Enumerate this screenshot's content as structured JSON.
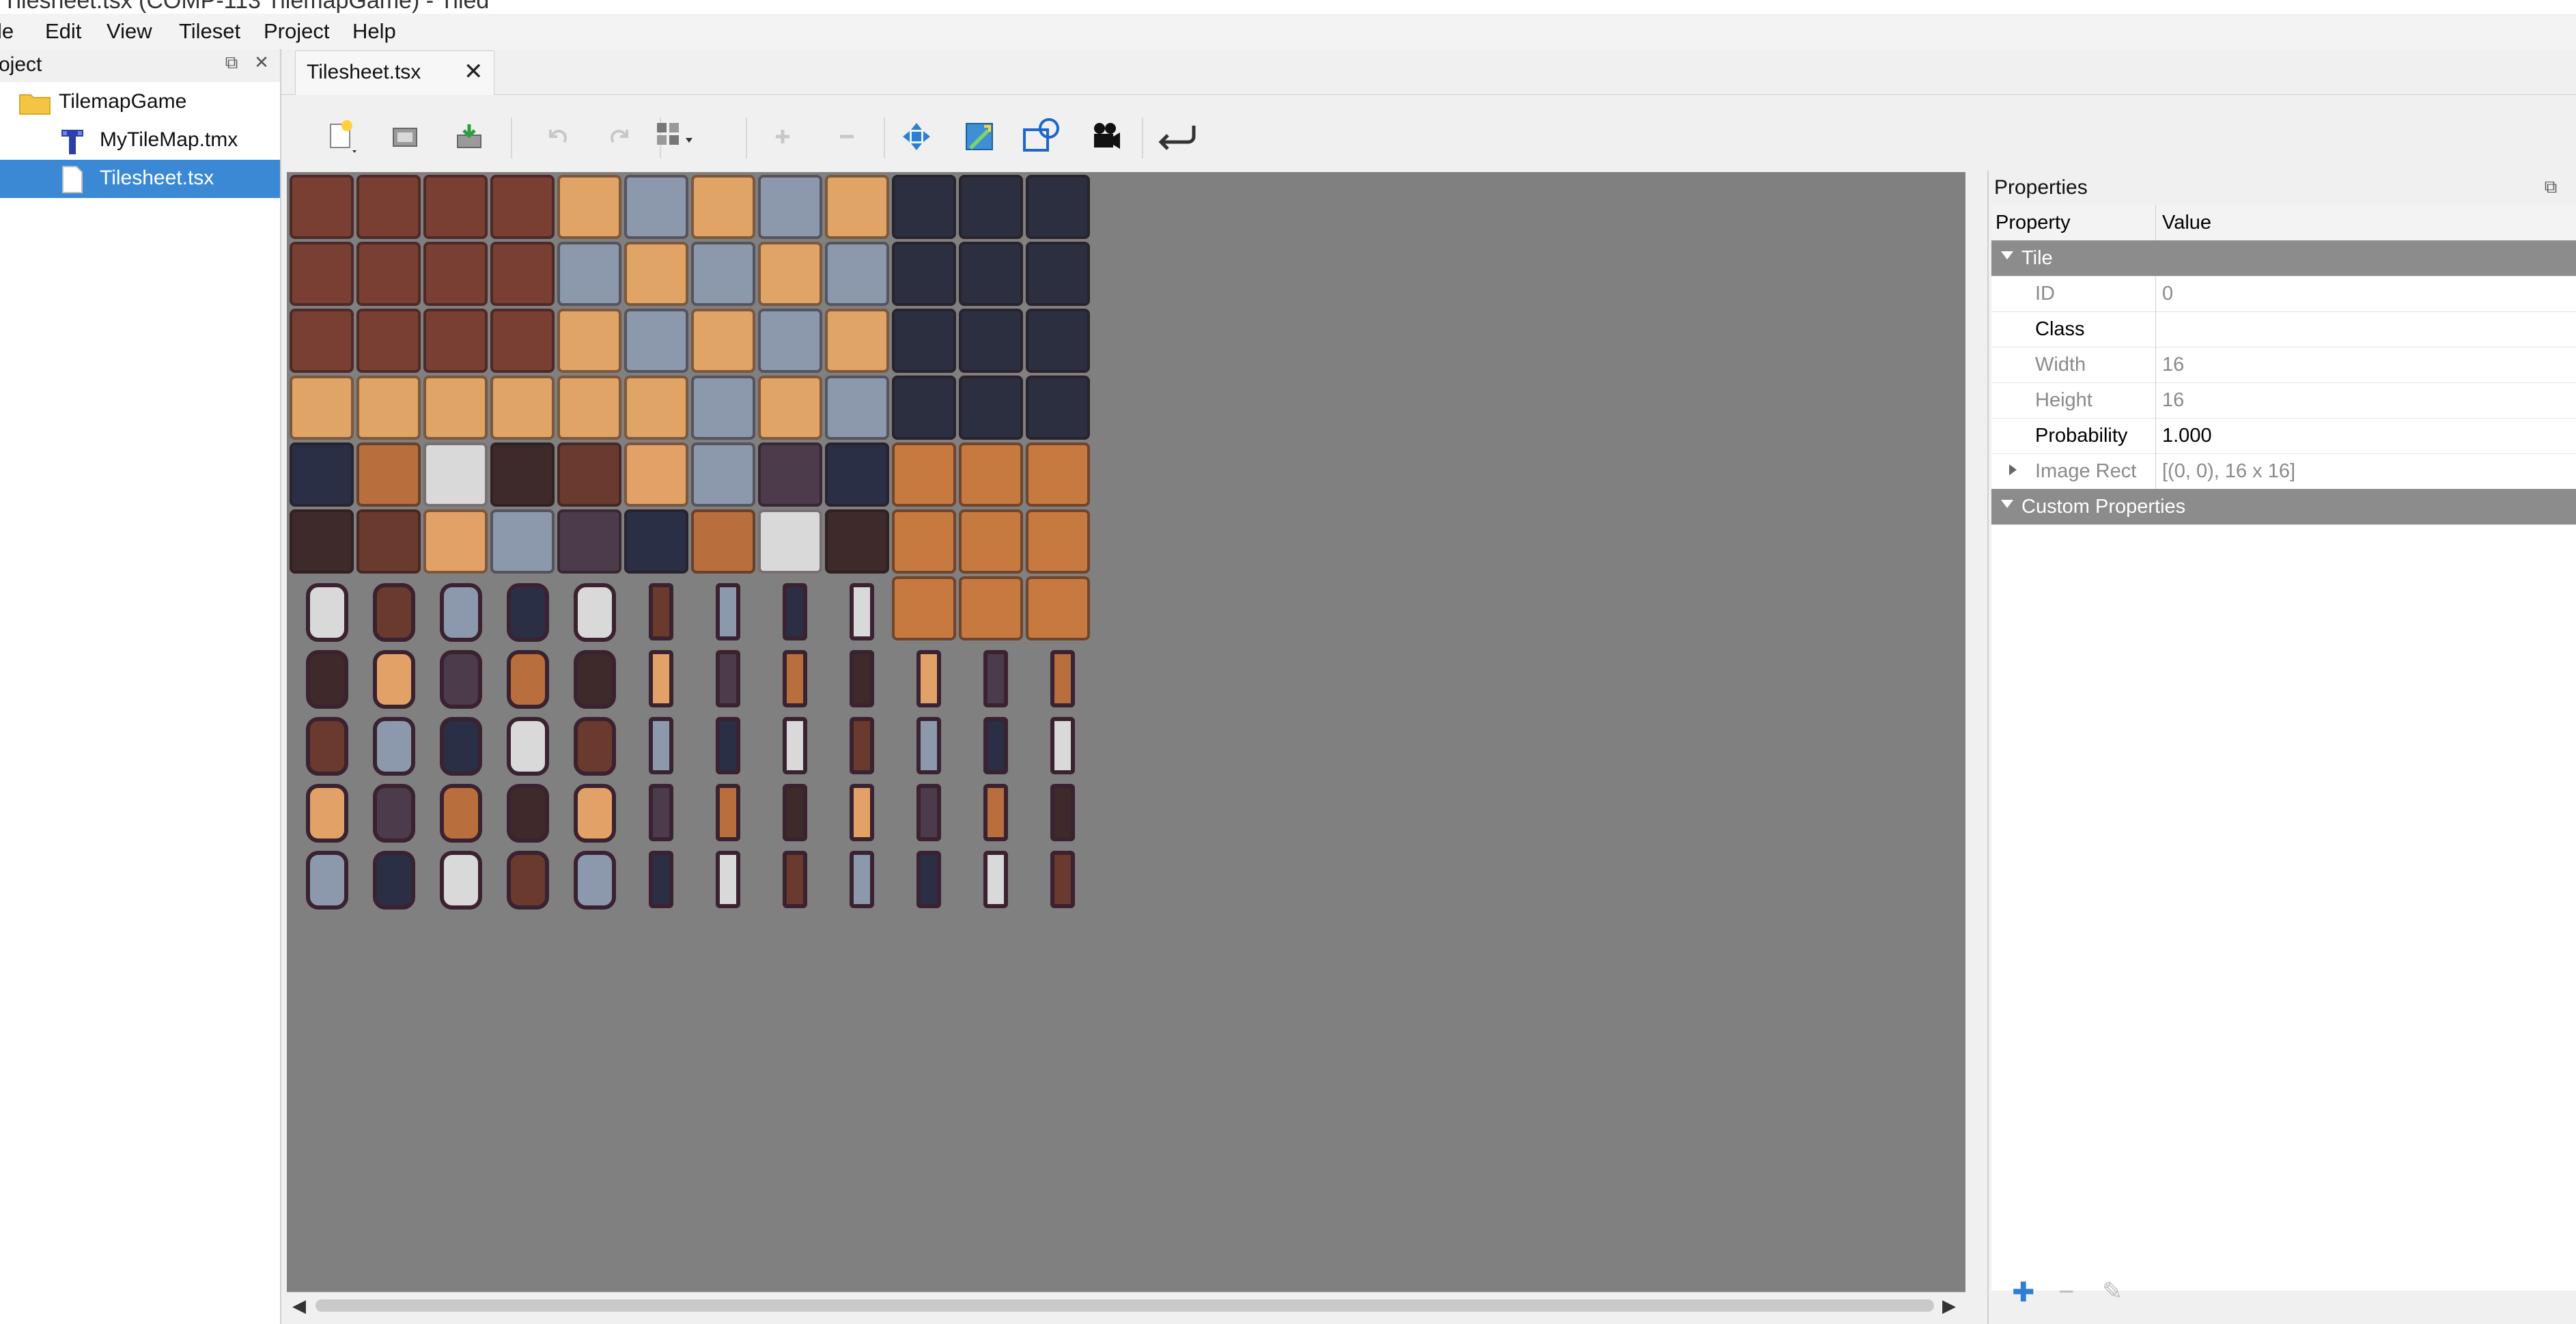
{
  "window": {
    "title": "Tilesheet.tsx (COMP-113 TilemapGame) - Tiled"
  },
  "menu": {
    "items": [
      "le",
      "Edit",
      "View",
      "Tileset",
      "Project",
      "Help"
    ]
  },
  "project_panel": {
    "title": "oject",
    "tree": [
      {
        "label": "TilemapGame",
        "icon": "folder-icon",
        "level": 0,
        "selected": false
      },
      {
        "label": "MyTileMap.tmx",
        "icon": "tilemap-icon",
        "level": 1,
        "selected": false
      },
      {
        "label": "Tilesheet.tsx",
        "icon": "file-icon",
        "level": 1,
        "selected": true
      }
    ]
  },
  "tabs": [
    {
      "label": "Tilesheet.tsx",
      "active": true
    }
  ],
  "toolbar": {
    "buttons": [
      "new-tileset-icon",
      "open-icon",
      "save-icon",
      "undo-icon",
      "redo-icon",
      "dynamic-wrapping-icon",
      "add-tiles-icon",
      "remove-tiles-icon",
      "move-icon",
      "edit-collision-icon",
      "shape-select-icon",
      "animation-editor-icon",
      "rearrange-icon"
    ]
  },
  "properties": {
    "title": "Properties",
    "header": {
      "property": "Property",
      "value": "Value"
    },
    "groups": [
      {
        "name": "Tile",
        "rows": [
          {
            "key": "ID",
            "value": "0",
            "editable": false
          },
          {
            "key": "Class",
            "value": "",
            "editable": true
          },
          {
            "key": "Width",
            "value": "16",
            "editable": false
          },
          {
            "key": "Height",
            "value": "16",
            "editable": false
          },
          {
            "key": "Probability",
            "value": "1.000",
            "editable": true
          },
          {
            "key": "Image Rect",
            "value": "[(0, 0), 16 x 16]",
            "editable": false
          }
        ]
      },
      {
        "name": "Custom Properties",
        "rows": []
      }
    ]
  },
  "colors": {
    "selection": "#3b89d5",
    "canvas": "#808080",
    "group_header": "#8c8c8c"
  }
}
